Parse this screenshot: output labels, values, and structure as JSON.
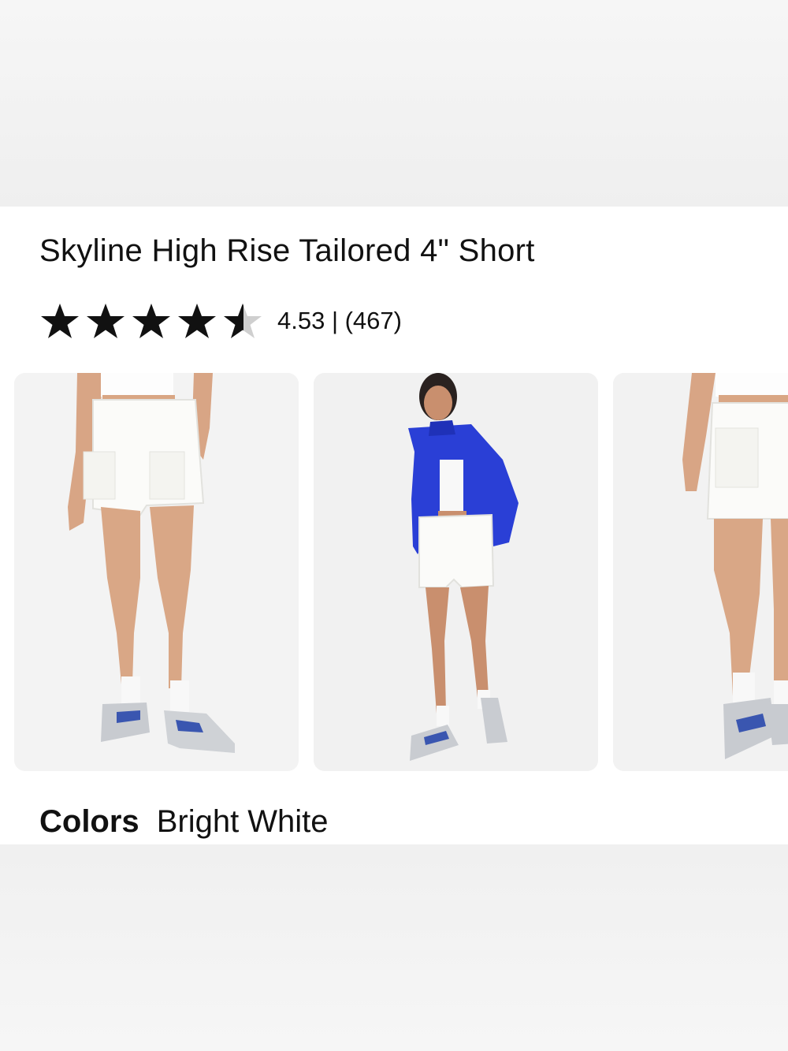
{
  "product": {
    "title": "Skyline High Rise Tailored 4\" Short",
    "rating": {
      "stars_filled_fraction": 4.53,
      "max_stars": 5,
      "text": "4.53 | (467)"
    }
  },
  "gallery": {
    "images": [
      {
        "icon": "model-legs-front-shorts-image"
      },
      {
        "icon": "model-full-body-blue-jacket-image"
      },
      {
        "icon": "model-legs-back-shorts-image"
      }
    ]
  },
  "colors": {
    "label": "Colors",
    "value": "Bright White"
  },
  "palette": {
    "star": "#111111",
    "star_empty": "#cfcfcf",
    "jacket": "#2a3fd6",
    "skin": "#d9a887",
    "shorts": "#fbfbf9"
  }
}
